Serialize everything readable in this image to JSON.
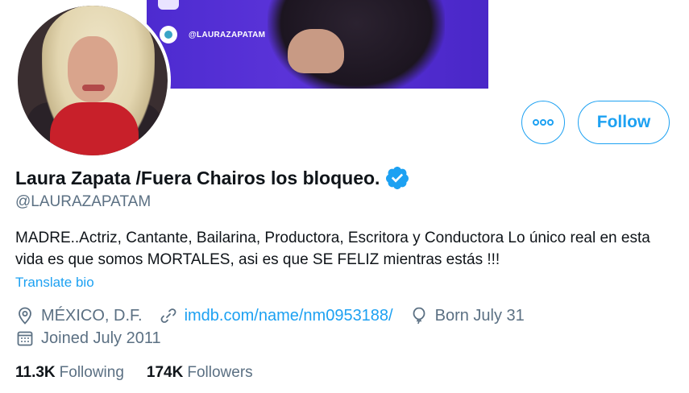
{
  "banner": {
    "handle_text": "@LAURAZAPATAM"
  },
  "actions": {
    "more_label": "More",
    "follow_label": "Follow"
  },
  "profile": {
    "display_name": "Laura Zapata /Fuera Chairos los bloqueo.",
    "handle": "@LAURAZAPATAM",
    "bio": "MADRE..Actriz, Cantante, Bailarina, Productora, Escritora y Conductora Lo único real en esta vida es que somos MORTALES, asi es que SE FELIZ mientras estás !!!",
    "translate_label": "Translate bio",
    "location": "MÉXICO, D.F.",
    "website": "imdb.com/name/nm0953188/",
    "birthday": "Born July 31",
    "joined": "Joined July 2011"
  },
  "stats": {
    "following_count": "11.3K",
    "following_label": "Following",
    "followers_count": "174K",
    "followers_label": "Followers"
  },
  "icons": {
    "verified": "verified-badge-icon",
    "location": "location-pin-icon",
    "link": "link-icon",
    "birthday": "balloon-icon",
    "joined": "calendar-icon",
    "more": "more-dots-icon"
  },
  "colors": {
    "accent": "#1da1f2",
    "secondary_text": "#5b7083",
    "primary_text": "#0f1419",
    "banner": "#4d2bd0"
  }
}
